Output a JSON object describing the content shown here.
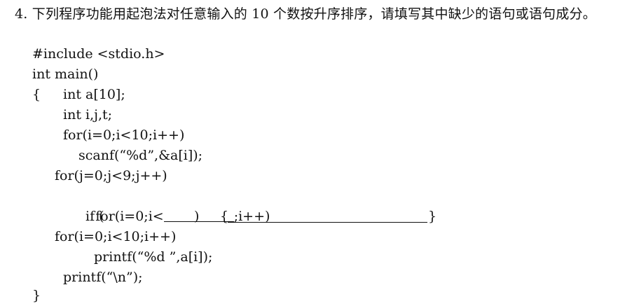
{
  "question": {
    "number": "4.",
    "text": "下列程序功能用起泡法对任意输入的 10 个数按升序排序，请填写其中缺少的语句或语句成分。"
  },
  "code": {
    "line1": "#include <stdio.h>",
    "line2": "int main()",
    "line3_open": "{",
    "line3_code": "int a[10];",
    "line4": "int i,j,t;",
    "line5": "for(i=0;i<10;i++)",
    "line6": "scanf(“%d”,&a[i]);",
    "line7": "for(j=0;j<9;j++)",
    "line8_before": "for(i=0;i<",
    "line8_after": ";i++)",
    "line9_if": "if (",
    "line9_close_paren": ")",
    "line9_open_brace": "{",
    "line9_close_brace": "}",
    "line10": "for(i=0;i<10;i++)",
    "line11": "printf(“%d ”,a[i]);",
    "line12": "printf(“\\n”);",
    "line13": "}"
  }
}
